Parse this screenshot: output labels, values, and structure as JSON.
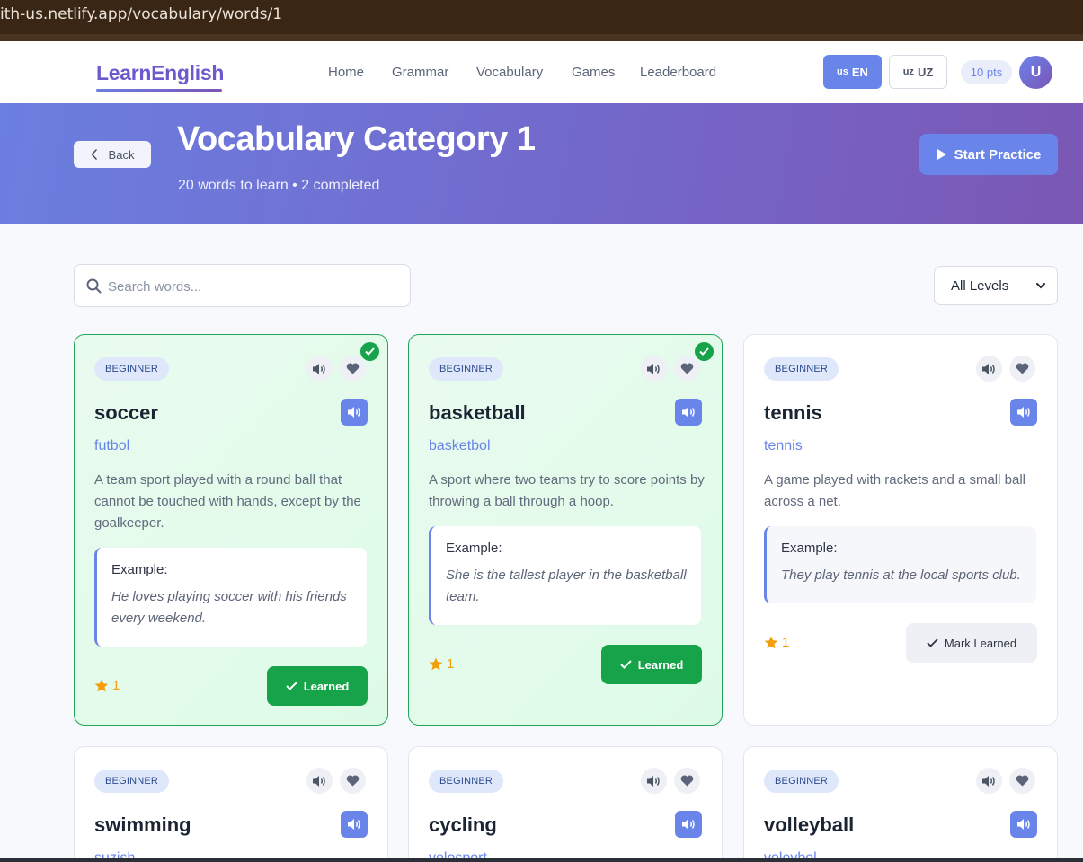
{
  "browser": {
    "url": "ith-us.netlify.app/vocabulary/words/1"
  },
  "header": {
    "logo": "LearnEnglish",
    "nav": [
      "Home",
      "Grammar",
      "Vocabulary",
      "Games",
      "Leaderboard"
    ],
    "lang_en_flag": "us",
    "lang_en": "EN",
    "lang_uz_flag": "uz",
    "lang_uz": "UZ",
    "points": "10 pts",
    "avatar": "U"
  },
  "hero": {
    "back": "Back",
    "title": "Vocabulary Category 1",
    "subtitle": "20 words to learn • 2 completed",
    "start": "Start Practice"
  },
  "filters": {
    "search_placeholder": "Search words...",
    "level": "All Levels"
  },
  "cards": [
    {
      "level": "BEGINNER",
      "word": "soccer",
      "translation": "futbol",
      "definition": "A team sport played with a round ball that cannot be touched with hands, except by the goalkeeper.",
      "example_label": "Example:",
      "example": "He loves playing soccer with his friends every weekend.",
      "stars": "1",
      "status": "Learned",
      "learned": true
    },
    {
      "level": "BEGINNER",
      "word": "basketball",
      "translation": "basketbol",
      "definition": "A sport where two teams try to score points by throwing a ball through a hoop.",
      "example_label": "Example:",
      "example": "She is the tallest player in the basketball team.",
      "stars": "1",
      "status": "Learned",
      "learned": true
    },
    {
      "level": "BEGINNER",
      "word": "tennis",
      "translation": "tennis",
      "definition": "A game played with rackets and a small ball across a net.",
      "example_label": "Example:",
      "example": "They play tennis at the local sports club.",
      "stars": "1",
      "status": "Mark Learned",
      "learned": false
    },
    {
      "level": "BEGINNER",
      "word": "swimming",
      "translation": "suzish",
      "learned": false
    },
    {
      "level": "BEGINNER",
      "word": "cycling",
      "translation": "velosport",
      "learned": false
    },
    {
      "level": "BEGINNER",
      "word": "volleyball",
      "translation": "voleybol",
      "learned": false
    }
  ],
  "colors": {
    "accent": "#6a85ea",
    "success": "#16a34a",
    "star": "#f59e0b"
  }
}
